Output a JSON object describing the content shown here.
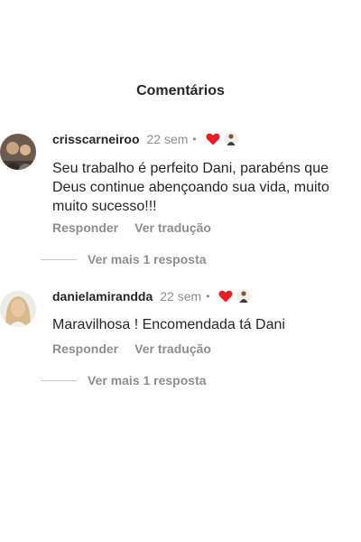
{
  "header": {
    "title": "Comentários"
  },
  "comments": [
    {
      "username": "crisscarneiroo",
      "time": "22 sem",
      "dot": "•",
      "text": "Seu trabalho é perfeito Dani, parabéns que Deus continue abençoando sua vida, muito muito sucesso!!!",
      "reply_label": "Responder",
      "translate_label": "Ver tradução",
      "more_replies_label": "Ver mais 1 resposta"
    },
    {
      "username": "danielamirandda",
      "time": "22 sem",
      "dot": "•",
      "text": "Maravilhosa ! Encomendada tá Dani",
      "reply_label": "Responder",
      "translate_label": "Ver tradução",
      "more_replies_label": "Ver mais 1 resposta"
    }
  ],
  "colors": {
    "heart": "#ed1c24",
    "secondary_text": "#8e8e8e"
  }
}
